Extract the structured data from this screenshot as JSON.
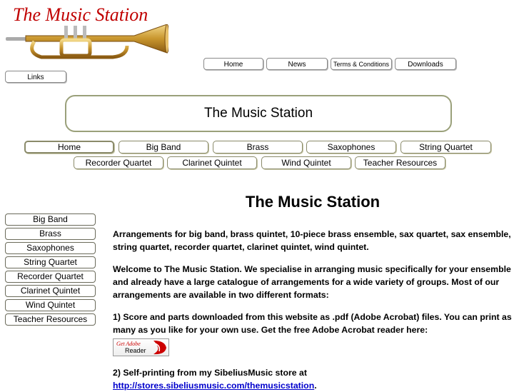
{
  "logo": {
    "text": "The Music Station"
  },
  "top_nav": [
    "Home",
    "News",
    "Terms & Conditions",
    "Downloads",
    "Links"
  ],
  "banner": {
    "title": "The Music Station"
  },
  "main_nav_row1": [
    "Home",
    "Big Band",
    "Brass",
    "Saxophones",
    "String Quartet"
  ],
  "main_nav_row2": [
    "Recorder Quartet",
    "Clarinet Quintet",
    "Wind Quintet",
    "Teacher Resources"
  ],
  "side_nav": [
    "Big Band",
    "Brass",
    "Saxophones",
    "String Quartet",
    "Recorder Quartet",
    "Clarinet Quintet",
    "Wind Quintet",
    "Teacher Resources"
  ],
  "content": {
    "heading": "The Music Station",
    "intro": "Arrangements for big band, brass quintet, 10-piece brass ensemble, sax quartet, sax ensemble, string quartet, recorder quartet, clarinet quintet, wind quintet.",
    "welcome": "Welcome to The Music Station. We specialise in arranging music specifically for your ensemble and already have a large catalogue of arrangements for a wide variety of groups.  Most of our arrangements are available in two different formats:",
    "format1": "1) Score and parts downloaded from this website as .pdf (Adobe Acrobat) files. You can print as many as you like for your own use. Get the free Adobe Acrobat reader here:",
    "adobe_badge": {
      "line1": "Get Adobe",
      "line2": "Reader"
    },
    "format2_prefix": "2) Self-printing from my SibeliusMusic store at",
    "format2_link": "http://stores.sibeliusmusic.com/themusicstation",
    "format2_suffix": "."
  },
  "colors": {
    "logo_red": "#c00000",
    "link_blue": "#0000cc",
    "adobe_red": "#cc0000",
    "border_olive": "#9aa07a"
  }
}
